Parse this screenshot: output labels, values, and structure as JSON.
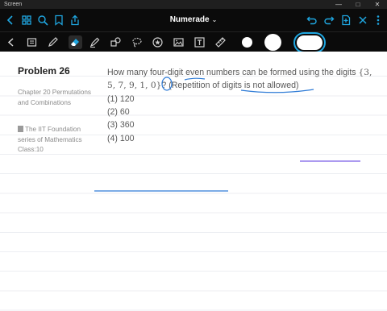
{
  "window": {
    "title": "Screen",
    "controls": [
      "—",
      "□",
      "✕"
    ]
  },
  "app": {
    "title": "Numerade",
    "caret": "⌄"
  },
  "toolbar": {
    "left_icons": [
      "back-icon",
      "grid-icon",
      "search-icon",
      "bookmark-icon",
      "share-icon"
    ],
    "right_icons": [
      "undo-icon",
      "redo-icon",
      "add-page-icon",
      "close-icon",
      "more-icon"
    ],
    "tools": [
      "notebook-icon",
      "pen-icon",
      "eraser-icon",
      "highlighter-icon",
      "shapes-icon",
      "lasso-icon",
      "sticker-icon",
      "image-icon",
      "text-icon",
      "ruler-icon"
    ],
    "colors": [
      "#ffffff",
      "#ffffff",
      "#ffffff"
    ],
    "accent": "#1fa6e0"
  },
  "problem": {
    "title": "Problem 26",
    "chapter": "Chapter 20 Permutations and Combinations",
    "book": "The IIT Foundation series of Mathematics Class:10",
    "question_part1": "How many four-digit even numbers can be formed using the digits",
    "question_set": "{3, 5, 7, 9, 1, 0}",
    "question_part2": "? (Repetition of digits is not allowed)",
    "options": [
      "(1) 120",
      "(2) 60",
      "(3) 360",
      "(4) 100"
    ]
  },
  "ink_color": "#2e7bd6",
  "ink_color_2": "#7b5ee6"
}
